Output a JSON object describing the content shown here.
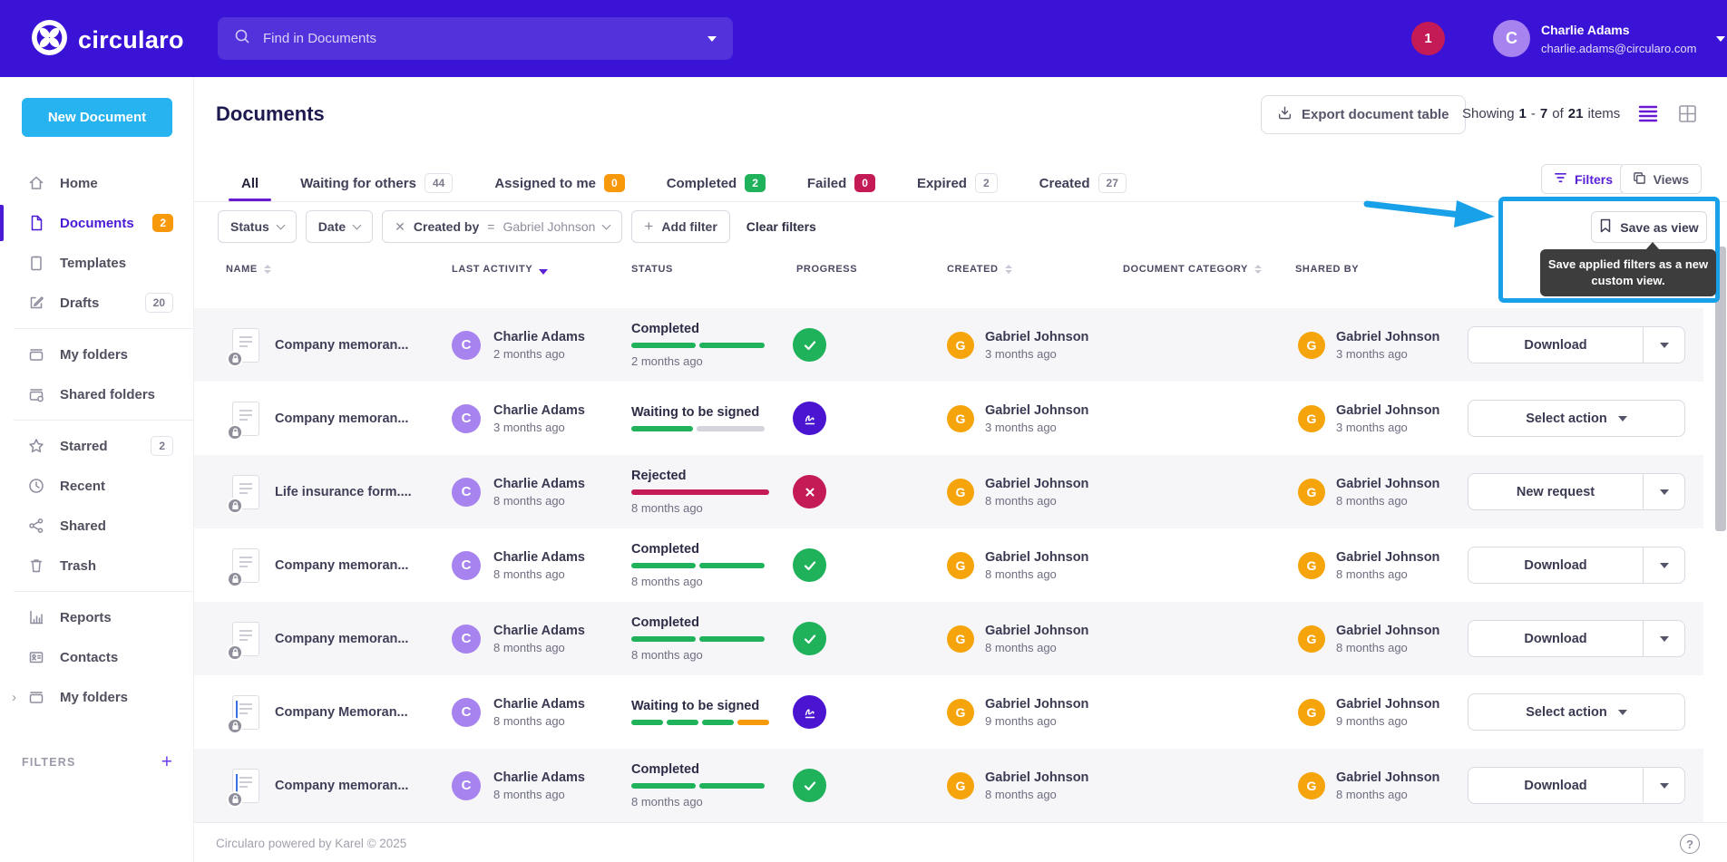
{
  "topbar": {
    "brand": "circularo",
    "search_placeholder": "Find in Documents",
    "notification_count": "1",
    "user": {
      "initial": "C",
      "name": "Charlie Adams",
      "email": "charlie.adams@circularo.com"
    }
  },
  "sidebar": {
    "new_document_label": "New Document",
    "filters_label": "FILTERS",
    "filters_plus": "+",
    "groups": [
      [
        {
          "label": "Home",
          "icon": "home"
        },
        {
          "label": "Documents",
          "icon": "document",
          "active": true,
          "badge": "2",
          "badge_style": "orange"
        },
        {
          "label": "Templates",
          "icon": "template"
        },
        {
          "label": "Drafts",
          "icon": "draft",
          "badge": "20",
          "badge_style": "outline"
        }
      ],
      [
        {
          "label": "My folders",
          "icon": "folder"
        },
        {
          "label": "Shared folders",
          "icon": "shared-folder"
        }
      ],
      [
        {
          "label": "Starred",
          "icon": "star",
          "badge": "2",
          "badge_style": "outline"
        },
        {
          "label": "Recent",
          "icon": "clock"
        },
        {
          "label": "Shared",
          "icon": "share"
        },
        {
          "label": "Trash",
          "icon": "trash"
        }
      ],
      [
        {
          "label": "Reports",
          "icon": "report"
        },
        {
          "label": "Contacts",
          "icon": "contact"
        },
        {
          "label": "My folders",
          "icon": "folder",
          "chevron": true
        }
      ]
    ]
  },
  "page": {
    "title": "Documents",
    "export_label": "Export document table",
    "showing": {
      "prefix": "Showing",
      "from": "1",
      "dash": "-",
      "to": "7",
      "of": "of",
      "total": "21",
      "suffix": "items"
    }
  },
  "tabs": [
    {
      "label": "All",
      "badge": null,
      "active": true
    },
    {
      "label": "Waiting for others",
      "badge": "44",
      "badge_style": "outline"
    },
    {
      "label": "Assigned to me",
      "badge": "0",
      "badge_style": "orange"
    },
    {
      "label": "Completed",
      "badge": "2",
      "badge_style": "green"
    },
    {
      "label": "Failed",
      "badge": "0",
      "badge_style": "crimson"
    },
    {
      "label": "Expired",
      "badge": "2",
      "badge_style": "outline"
    },
    {
      "label": "Created",
      "badge": "27",
      "badge_style": "outline"
    }
  ],
  "toolbar": {
    "filters_label": "Filters",
    "views_label": "Views"
  },
  "filter_bar": {
    "chips": [
      {
        "label": "Status"
      },
      {
        "label": "Date"
      }
    ],
    "created_by": {
      "remove_glyph": "✕",
      "field": "Created by",
      "operator": "=",
      "value": "Gabriel Johnson"
    },
    "add_filter_glyph": "+",
    "add_filter_label": "Add filter",
    "clear_filters_label": "Clear filters"
  },
  "save_view": {
    "button_label": "Save as view",
    "tooltip": "Save applied filters as a new custom view."
  },
  "palette": {
    "green": "#1fb25a",
    "gray": "#d4d4dc",
    "crimson": "#c41a55",
    "orange": "#f59b0b",
    "topbar": "#3a13d6",
    "highlight": "#18a0e8",
    "new_document": "#27b2f0",
    "avatar_c": "#a683ee",
    "avatar_g": "#f5a40c",
    "signature_icon": "#4a14d0",
    "active_purple": "#4a1ad6"
  },
  "table": {
    "columns": [
      {
        "label": "NAME",
        "sort": "both"
      },
      {
        "label": "LAST ACTIVITY",
        "sort": "desc-active"
      },
      {
        "label": "STATUS",
        "sort": "none"
      },
      {
        "label": "PROGRESS",
        "sort": "none"
      },
      {
        "label": "CREATED",
        "sort": "both"
      },
      {
        "label": "DOCUMENT CATEGORY",
        "sort": "both"
      },
      {
        "label": "SHARED BY",
        "sort": "none"
      }
    ],
    "progress_styles": {
      "completed": [
        [
          "green",
          47
        ],
        [
          "green",
          47
        ]
      ],
      "waiting_half": [
        [
          "green",
          45
        ],
        [
          "gray",
          49
        ]
      ],
      "rejected": [
        [
          "crimson",
          100
        ]
      ],
      "waiting_multi": [
        [
          "green",
          23
        ],
        [
          "green",
          23
        ],
        [
          "green",
          23
        ],
        [
          "orange",
          23
        ]
      ]
    },
    "rows": [
      {
        "name": "Company memoran...",
        "doc_accent": false,
        "activity_initial": "C",
        "activity_user": "Charlie Adams",
        "activity_time": "2 months ago",
        "status": "Completed",
        "status_time": "2 months ago",
        "progress": "completed",
        "status_icon": "check",
        "created_initial": "G",
        "created_user": "Gabriel Johnson",
        "created_time": "3 months ago",
        "shared_initial": "G",
        "shared_user": "Gabriel Johnson",
        "shared_time": "3 months ago",
        "action_label": "Download",
        "action_split": true
      },
      {
        "name": "Company memoran...",
        "doc_accent": false,
        "activity_initial": "C",
        "activity_user": "Charlie Adams",
        "activity_time": "3 months ago",
        "status": "Waiting to be signed",
        "status_time": "",
        "progress": "waiting_half",
        "status_icon": "signature",
        "created_initial": "G",
        "created_user": "Gabriel Johnson",
        "created_time": "3 months ago",
        "shared_initial": "G",
        "shared_user": "Gabriel Johnson",
        "shared_time": "3 months ago",
        "action_label": "Select action",
        "action_split": false
      },
      {
        "name": "Life insurance form....",
        "doc_accent": false,
        "activity_initial": "C",
        "activity_user": "Charlie Adams",
        "activity_time": "8 months ago",
        "status": "Rejected",
        "status_time": "8 months ago",
        "progress": "rejected",
        "status_icon": "cross",
        "created_initial": "G",
        "created_user": "Gabriel Johnson",
        "created_time": "8 months ago",
        "shared_initial": "G",
        "shared_user": "Gabriel Johnson",
        "shared_time": "8 months ago",
        "action_label": "New request",
        "action_split": true
      },
      {
        "name": "Company memoran...",
        "doc_accent": false,
        "activity_initial": "C",
        "activity_user": "Charlie Adams",
        "activity_time": "8 months ago",
        "status": "Completed",
        "status_time": "8 months ago",
        "progress": "completed",
        "status_icon": "check",
        "created_initial": "G",
        "created_user": "Gabriel Johnson",
        "created_time": "8 months ago",
        "shared_initial": "G",
        "shared_user": "Gabriel Johnson",
        "shared_time": "8 months ago",
        "action_label": "Download",
        "action_split": true
      },
      {
        "name": "Company memoran...",
        "doc_accent": false,
        "activity_initial": "C",
        "activity_user": "Charlie Adams",
        "activity_time": "8 months ago",
        "status": "Completed",
        "status_time": "8 months ago",
        "progress": "completed",
        "status_icon": "check",
        "created_initial": "G",
        "created_user": "Gabriel Johnson",
        "created_time": "8 months ago",
        "shared_initial": "G",
        "shared_user": "Gabriel Johnson",
        "shared_time": "8 months ago",
        "action_label": "Download",
        "action_split": true
      },
      {
        "name": "Company Memoran...",
        "doc_accent": true,
        "activity_initial": "C",
        "activity_user": "Charlie Adams",
        "activity_time": "8 months ago",
        "status": "Waiting to be signed",
        "status_time": "",
        "progress": "waiting_multi",
        "status_icon": "signature",
        "created_initial": "G",
        "created_user": "Gabriel Johnson",
        "created_time": "9 months ago",
        "shared_initial": "G",
        "shared_user": "Gabriel Johnson",
        "shared_time": "9 months ago",
        "action_label": "Select action",
        "action_split": false
      },
      {
        "name": "Company memoran...",
        "doc_accent": true,
        "activity_initial": "C",
        "activity_user": "Charlie Adams",
        "activity_time": "8 months ago",
        "status": "Completed",
        "status_time": "8 months ago",
        "progress": "completed",
        "status_icon": "check",
        "created_initial": "G",
        "created_user": "Gabriel Johnson",
        "created_time": "8 months ago",
        "shared_initial": "G",
        "shared_user": "Gabriel Johnson",
        "shared_time": "8 months ago",
        "action_label": "Download",
        "action_split": true
      }
    ]
  },
  "footer": {
    "text": "Circularo powered by Karel © 2025",
    "help_glyph": "?"
  }
}
